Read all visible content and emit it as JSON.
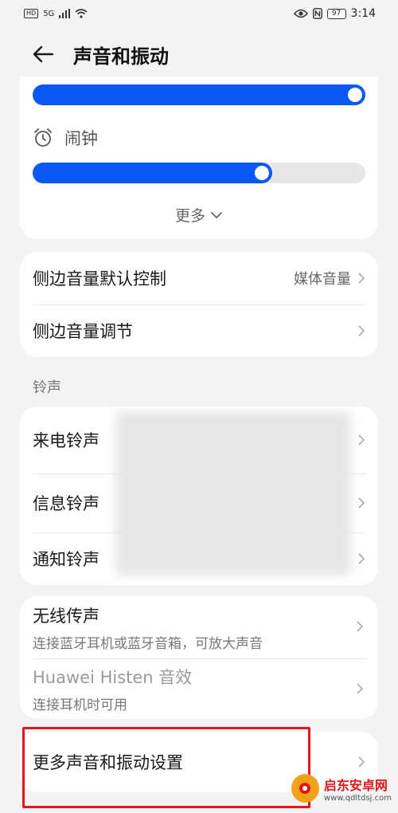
{
  "status_bar": {
    "hd": "HD",
    "network": "5G",
    "battery": "97",
    "time": "3:14",
    "icons": [
      "hd-icon",
      "signal-icon",
      "wifi-icon",
      "eye-icon",
      "nfc-icon",
      "battery-icon"
    ]
  },
  "header": {
    "title": "声音和振动",
    "back_icon": "back-arrow-icon"
  },
  "volume_card": {
    "top_slider_level": 1.0,
    "alarm_label": "闹钟",
    "alarm_icon": "alarm-clock-icon",
    "alarm_slider_level": 0.72,
    "more_label": "更多",
    "accent_color": "#0a59f7"
  },
  "side_volume_card": {
    "items": [
      {
        "label": "侧边音量默认控制",
        "value": "媒体音量"
      },
      {
        "label": "侧边音量调节",
        "value": ""
      }
    ]
  },
  "ringtone_section": {
    "header": "铃声",
    "items": [
      {
        "label": "来电铃声"
      },
      {
        "label": "信息铃声"
      },
      {
        "label": "通知铃声"
      }
    ]
  },
  "audio_card": {
    "items": [
      {
        "label": "无线传声",
        "subtitle": "连接蓝牙耳机或蓝牙音箱，可放大声音"
      },
      {
        "label": "Huawei Histen 音效",
        "subtitle": "连接耳机时可用"
      }
    ]
  },
  "more_settings": {
    "label": "更多声音和振动设置"
  },
  "watermark": {
    "title": "启东安卓网",
    "url": "www.qdltdsj.com"
  }
}
